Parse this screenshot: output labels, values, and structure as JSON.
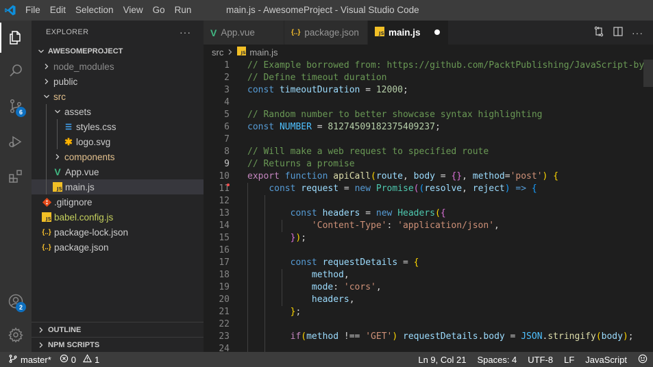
{
  "titlebar": {
    "menus": [
      "File",
      "Edit",
      "Selection",
      "View",
      "Go",
      "Run"
    ],
    "title": "main.js - AwesomeProject - Visual Studio Code"
  },
  "activity": {
    "scm_badge": "6",
    "accounts_badge": "2"
  },
  "explorer": {
    "header": "EXPLORER",
    "more": "···",
    "project": "AWESOMEPROJECT",
    "items": [
      {
        "label": "node_modules",
        "kind": "folder"
      },
      {
        "label": "public",
        "kind": "folder"
      },
      {
        "label": "src",
        "kind": "folder-open"
      },
      {
        "label": "assets",
        "kind": "folder-open"
      },
      {
        "label": "styles.css",
        "kind": "css"
      },
      {
        "label": "logo.svg",
        "kind": "svg"
      },
      {
        "label": "components",
        "kind": "folder"
      },
      {
        "label": "App.vue",
        "kind": "vue"
      },
      {
        "label": "main.js",
        "kind": "js"
      },
      {
        "label": ".gitignore",
        "kind": "git"
      },
      {
        "label": "babel.config.js",
        "kind": "js"
      },
      {
        "label": "package-lock.json",
        "kind": "json"
      },
      {
        "label": "package.json",
        "kind": "json"
      }
    ],
    "outline": "OUTLINE",
    "npm": "NPM SCRIPTS"
  },
  "tabs": [
    {
      "label": "App.vue",
      "icon": "V"
    },
    {
      "label": "package.json",
      "icon": "{..}"
    },
    {
      "label": "main.js",
      "icon": "JS"
    }
  ],
  "breadcrumb": {
    "folder": "src",
    "file": "main.js"
  },
  "code_lines": [
    "// Example borrowed from: https://github.com/PacktPublishing/JavaScript-by",
    "// Define timeout duration",
    "const timeoutDuration = 12000;",
    "",
    "// Random number to better showcase syntax highlighting",
    "const NUMBER = 81274509182375409237;",
    "",
    "// Will make a web request to specified route",
    "// Returns a promise",
    "export function apiCall(route, body = {}, method='post') {",
    "    const request = new Promise((resolve, reject) => {",
    "",
    "        const headers = new Headers({",
    "            'Content-Type': 'application/json',",
    "        });",
    "",
    "        const requestDetails = {",
    "            method,",
    "            mode: 'cors',",
    "            headers,",
    "        };",
    "",
    "        if(method !== 'GET') requestDetails.body = JSON.stringify(body);",
    ""
  ],
  "line_numbers": [
    "1",
    "2",
    "3",
    "4",
    "5",
    "6",
    "7",
    "8",
    "9",
    "10",
    "11",
    "12",
    "13",
    "14",
    "15",
    "16",
    "17",
    "18",
    "19",
    "20",
    "21",
    "22",
    "23",
    "24"
  ],
  "statusbar": {
    "branch": "master*",
    "errors": "0",
    "warnings": "1",
    "position": "Ln 9, Col 21",
    "spaces": "Spaces: 4",
    "encoding": "UTF-8",
    "eol": "LF",
    "language": "JavaScript"
  }
}
